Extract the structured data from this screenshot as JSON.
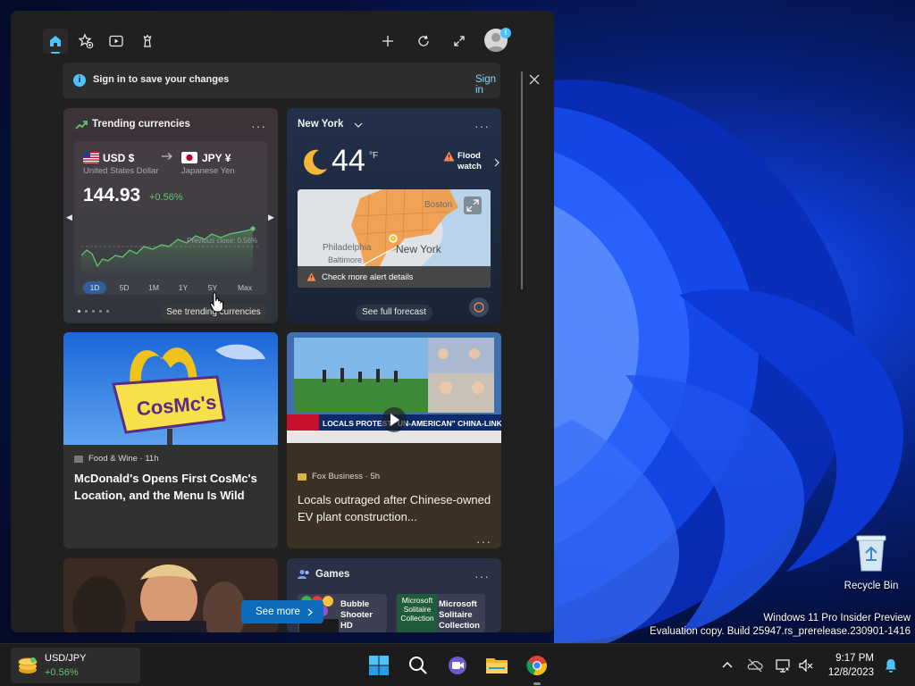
{
  "widgets_panel": {
    "signin_banner": {
      "message": "Sign in to save your changes",
      "link": "Sign in"
    },
    "currency_card": {
      "title": "Trending currencies",
      "from_code": "USD $",
      "from_name": "United States Dollar",
      "to_code": "JPY ¥",
      "to_name": "Japanese Yen",
      "rate": "144.93",
      "change": "+0.56%",
      "chart_label": "Previous close: 0.56%",
      "ranges": [
        "1D",
        "5D",
        "1M",
        "1Y",
        "5Y",
        "Max"
      ],
      "active_range": "1D",
      "see_more": "See trending currencies"
    },
    "weather_card": {
      "city": "New York",
      "temperature": "44",
      "unit": "°F",
      "alert_line1": "Flood",
      "alert_line2": "watch",
      "map_labels": [
        "Boston",
        "New York",
        "Philadelphia",
        "Baltimore"
      ],
      "alert_details": "Check more alert details",
      "see_forecast": "See full forecast"
    },
    "news": [
      {
        "source": "Food & Wine · 11h",
        "headline": "McDonald's Opens First CosMc's Location, and the Menu Is Wild",
        "image_text": "CosMc's"
      },
      {
        "source": "Fox Business · 5h",
        "headline": "Locals outraged after Chinese-owned EV plant construction...",
        "image_text": "LOCALS PROTEST \"UN-AMERICAN\" CHINA-LINKED EV PLANT"
      }
    ],
    "games_card": {
      "title": "Games",
      "items": [
        {
          "name_line1": "Bubble",
          "name_line2": "Shooter",
          "name_line3": "HD"
        },
        {
          "name_line1": "Microsoft",
          "name_line2": "Solitaire",
          "name_line3": "Collection",
          "tile_text_1": "Microsoft",
          "tile_text_2": "Solitaire",
          "tile_text_3": "Collection"
        }
      ]
    },
    "see_more_button": "See more"
  },
  "desktop": {
    "recycle_bin": "Recycle Bin",
    "watermark_line1": "Windows 11 Pro Insider Preview",
    "watermark_line2": "Evaluation copy. Build 25947.rs_prerelease.230901-1416"
  },
  "taskbar": {
    "widget_name": "USD/JPY",
    "widget_change": "+0.56%",
    "time": "9:17 PM",
    "date": "12/8/2023"
  },
  "colors": {
    "accent": "#0f6cbd",
    "positive": "#63c46f",
    "link": "#8ed1ff"
  }
}
